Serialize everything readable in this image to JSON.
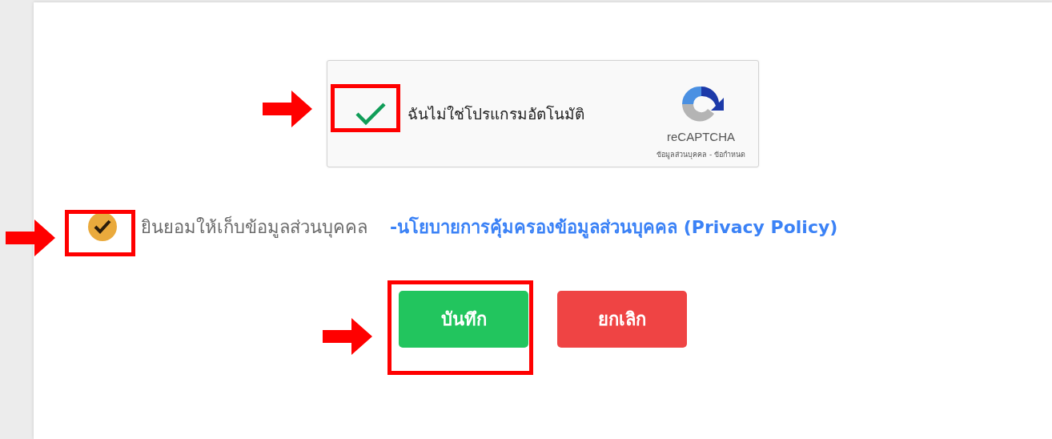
{
  "recaptcha": {
    "label": "ฉันไม่ใช่โปรแกรมอัตโนมัติ",
    "checked": true,
    "brand": "reCAPTCHA",
    "privacy": "ข้อมูลส่วนบุคคล",
    "separator": "-",
    "terms": "ข้อกำหนด"
  },
  "consent": {
    "label": "ยินยอมให้เก็บข้อมูลส่วนบุคคล",
    "checked": true,
    "link": "-นโยบายการคุ้มครองข้อมูลส่วนบุคคล (Privacy Policy)"
  },
  "buttons": [
    {
      "label": "บันทึก",
      "kind": "save"
    },
    {
      "label": "ยกเลิก",
      "kind": "cancel"
    }
  ]
}
